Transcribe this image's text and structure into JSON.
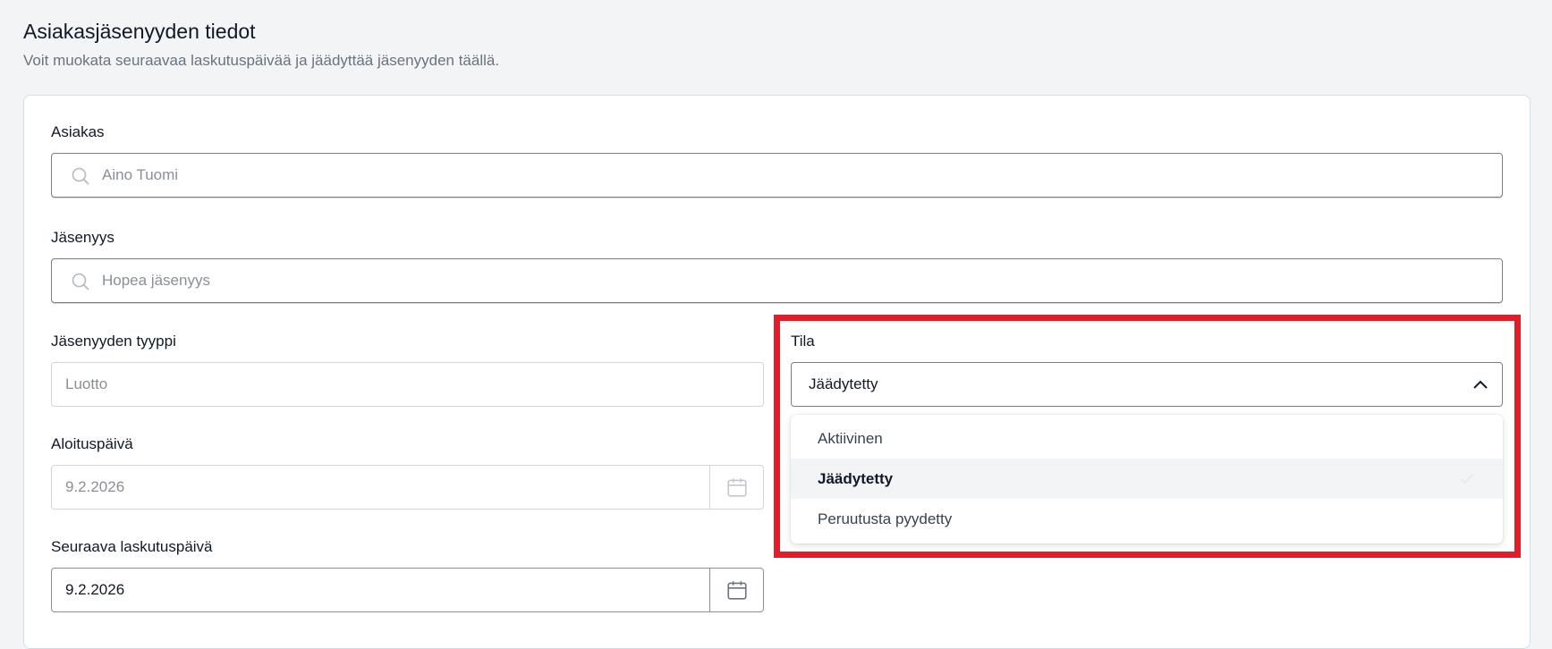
{
  "header": {
    "title": "Asiakasjäsenyyden tiedot",
    "subtitle": "Voit muokata seuraavaa laskutuspäivää ja jäädyttää jäsenyyden täällä."
  },
  "form": {
    "customer": {
      "label": "Asiakas",
      "value": "Aino Tuomi",
      "icon": "search-icon"
    },
    "membership": {
      "label": "Jäsenyys",
      "value": "Hopea jäsenyys",
      "icon": "search-icon"
    },
    "membership_type": {
      "label": "Jäsenyyden tyyppi",
      "value": "Luotto"
    },
    "start_date": {
      "label": "Aloituspäivä",
      "value": "9.2.2026",
      "icon": "calendar-icon"
    },
    "next_billing_date": {
      "label": "Seuraava laskutuspäivä",
      "value": "9.2.2026",
      "icon": "calendar-icon"
    },
    "status": {
      "label": "Tila",
      "value": "Jäädytetty",
      "icon": "chevron-up-icon",
      "options": [
        {
          "label": "Aktiivinen",
          "selected": false
        },
        {
          "label": "Jäädytetty",
          "selected": true
        },
        {
          "label": "Peruutusta pyydetty",
          "selected": false
        }
      ]
    }
  },
  "colors": {
    "highlight": "#e11d2a",
    "background": "#f3f4f6",
    "card_border": "#cfe0ee"
  }
}
